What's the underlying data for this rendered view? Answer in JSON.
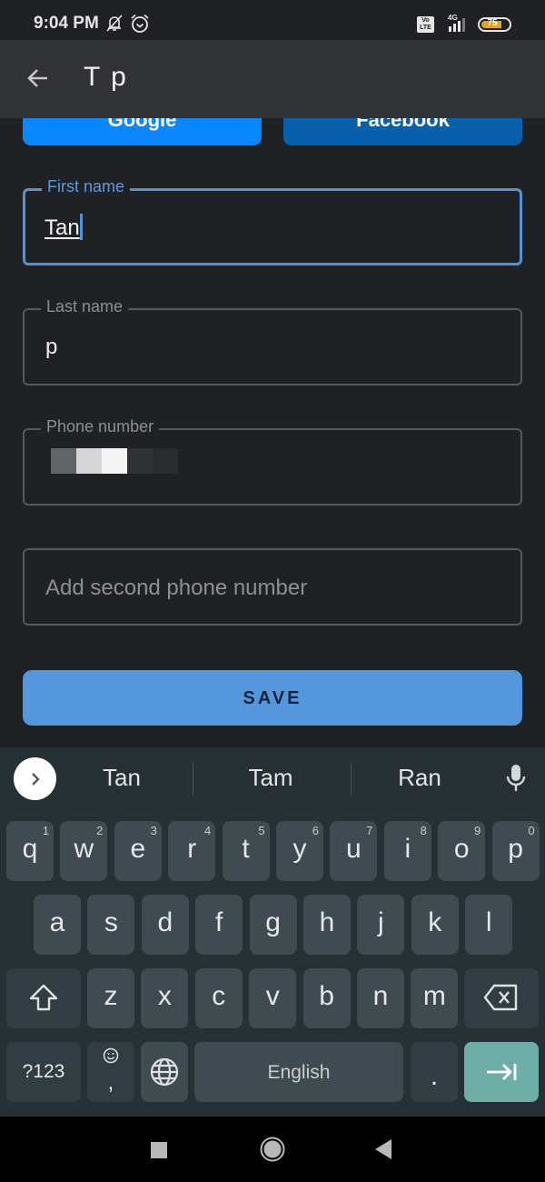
{
  "status_bar": {
    "time": "9:04 PM",
    "icons": [
      "bell-off-icon",
      "alarm-icon",
      "volte-icon",
      "signal-4g-icon",
      "battery-icon"
    ],
    "volte_label": "Vo LTE",
    "network_label": "4G",
    "battery_percent": 75,
    "battery_label": "75",
    "battery_color": "#e0a521"
  },
  "app_bar": {
    "title": "T p",
    "back_icon": "arrow-left-icon"
  },
  "social_buttons": {
    "google_label": "Google",
    "facebook_label": "Facebook",
    "google_color": "#0a86ff",
    "facebook_color": "#0860ad"
  },
  "form": {
    "first_name": {
      "label": "First name",
      "value": "Tan",
      "focused": true
    },
    "last_name": {
      "label": "Last name",
      "value": "p"
    },
    "phone_number": {
      "label": "Phone number",
      "value": "[redacted]"
    },
    "second_phone": {
      "placeholder": "Add second phone number"
    },
    "save_label": "SAVE",
    "accent_color": "#5692d3"
  },
  "keyboard": {
    "suggestions": [
      "Tan",
      "Tam",
      "Ran"
    ],
    "expand_icon": "chevron-right-icon",
    "mic_icon": "microphone-icon",
    "row1": [
      {
        "key": "q",
        "hint": "1"
      },
      {
        "key": "w",
        "hint": "2"
      },
      {
        "key": "e",
        "hint": "3"
      },
      {
        "key": "r",
        "hint": "4"
      },
      {
        "key": "t",
        "hint": "5"
      },
      {
        "key": "y",
        "hint": "6"
      },
      {
        "key": "u",
        "hint": "7"
      },
      {
        "key": "i",
        "hint": "8"
      },
      {
        "key": "o",
        "hint": "9"
      },
      {
        "key": "p",
        "hint": "0"
      }
    ],
    "row2": [
      "a",
      "s",
      "d",
      "f",
      "g",
      "h",
      "j",
      "k",
      "l"
    ],
    "row3": [
      "z",
      "x",
      "c",
      "v",
      "b",
      "n",
      "m"
    ],
    "symbols_label": "?123",
    "comma_label": ",",
    "space_label": "English",
    "period_label": ".",
    "shift_icon": "shift-icon",
    "backspace_icon": "backspace-icon",
    "emoji_icon": "emoji-icon",
    "globe_icon": "globe-icon",
    "enter_icon": "tab-next-icon"
  },
  "nav_bar": {
    "buttons": [
      "recents-square-icon",
      "home-circle-icon",
      "back-triangle-icon"
    ]
  }
}
